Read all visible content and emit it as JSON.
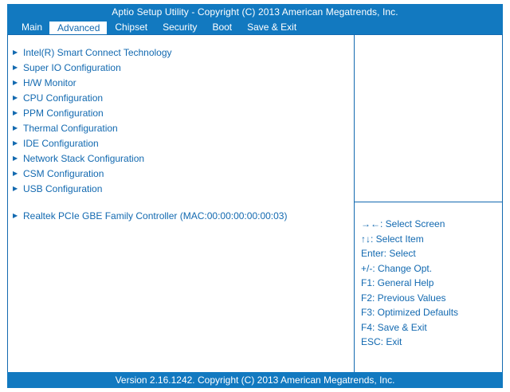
{
  "header": {
    "title": "Aptio Setup Utility - Copyright  (C)  2013 American Megatrends, Inc.",
    "tabs": [
      "Main",
      "Advanced",
      "Chipset",
      "Security",
      "Boot",
      "Save & Exit"
    ],
    "active_tab": "Advanced"
  },
  "menu": {
    "arrow": "▶",
    "items": [
      "Intel(R) Smart Connect Technology",
      "Super IO Configuration",
      "H/W Monitor",
      "CPU Configuration",
      "PPM Configuration",
      "Thermal Configuration",
      "IDE Configuration",
      "Network Stack Configuration",
      "CSM Configuration",
      "USB Configuration"
    ],
    "extra_item": "Realtek PCIe GBE Family Controller  (MAC:00:00:00:00:00:03)"
  },
  "help": {
    "lines": [
      "→←: Select Screen",
      "↑↓: Select Item",
      "Enter: Select",
      "+/-: Change Opt.",
      "F1: General Help",
      "F2: Previous Values",
      "F3: Optimized Defaults",
      "F4: Save & Exit",
      "ESC: Exit"
    ]
  },
  "footer": {
    "text": "Version 2.16.1242. Copyright  (C)  2013 American Megatrends, Inc."
  },
  "colors": {
    "accent": "#1279c0",
    "text": "#1269b0",
    "background": "#ffffff"
  }
}
